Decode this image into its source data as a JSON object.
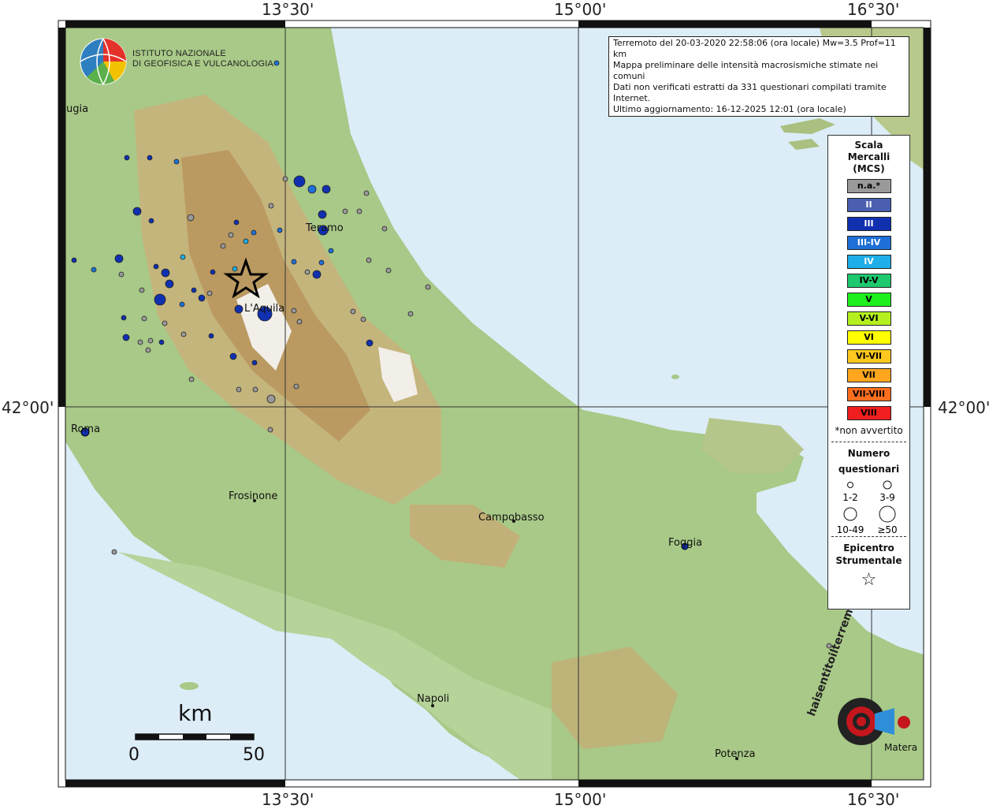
{
  "frame": {
    "top_labels": [
      "13°30'",
      "15°00'",
      "16°30'"
    ],
    "bottom_labels": [
      "13°30'",
      "15°00'",
      "16°30'"
    ],
    "left_label": "42°00'",
    "right_label": "42°00'"
  },
  "logo": {
    "line1": "ISTITUTO NAZIONALE",
    "line2": "DI GEOFISICA E VULCANOLOGIA"
  },
  "info": {
    "line1": "Terremoto del 20-03-2020 22:58:06 (ora locale) Mw=3.5 Prof=11 km",
    "line2": "Mappa preliminare delle intensità macrosismiche stimate nei comuni",
    "line3": "Dati non verificati estratti da 331 questionari compilati tramite Internet.",
    "line4": "Ultimo aggiornamento: 16-12-2025 12:01 (ora locale)"
  },
  "legend": {
    "title1": "Scala",
    "title2": "Mercalli",
    "title3": "(MCS)",
    "classes": [
      {
        "label": "n.a.*",
        "color": "#9a9a9a"
      },
      {
        "label": "II",
        "color": "#4a5fb0"
      },
      {
        "label": "III",
        "color": "#1030b0"
      },
      {
        "label": "III-IV",
        "color": "#1e6fd8"
      },
      {
        "label": "IV",
        "color": "#1eaee8"
      },
      {
        "label": "IV-V",
        "color": "#1ec86e"
      },
      {
        "label": "V",
        "color": "#1ef01e"
      },
      {
        "label": "V-VI",
        "color": "#b4f01e"
      },
      {
        "label": "VI",
        "color": "#ffff00"
      },
      {
        "label": "VI-VII",
        "color": "#ffc81e"
      },
      {
        "label": "VII",
        "color": "#ffa51e"
      },
      {
        "label": "VII-VIII",
        "color": "#ff6e1e"
      },
      {
        "label": "VIII",
        "color": "#f01e1e"
      }
    ],
    "na_note": "*non avvertito",
    "count_title1": "Numero",
    "count_title2": "questionari",
    "count_labels": [
      "1-2",
      "3-9",
      "10-49",
      "≥50"
    ],
    "epi_title1": "Epicentro",
    "epi_title2": "Strumentale"
  },
  "cities": {
    "perugia": "ugia",
    "roma": "Roma",
    "teramo": "Teramo",
    "laquila": "L'Aquila",
    "frosinone": "Frosinone",
    "campobasso": "Campobasso",
    "foggia": "Foggia",
    "napoli": "Napoli",
    "potenza": "Potenza",
    "matera": "Matera"
  },
  "scale": {
    "unit": "km",
    "min": "0",
    "max": "50"
  },
  "badge": {
    "text": "haisentitoilterremoto.it"
  }
}
